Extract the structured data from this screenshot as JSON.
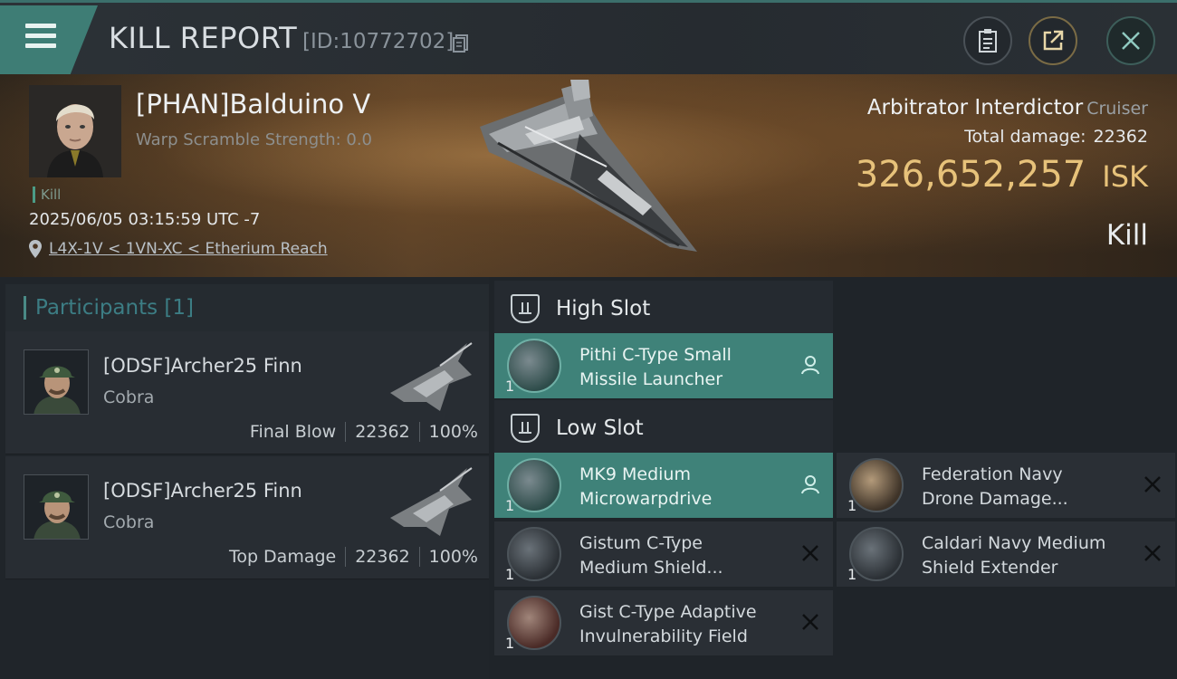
{
  "header": {
    "title": "KILL REPORT",
    "report_id": "[ID:10772702]"
  },
  "victim": {
    "name": "[PHAN]Balduino V",
    "warp_scramble": "Warp Scramble Strength: 0.0",
    "badge": "Kill",
    "timestamp": "2025/06/05 03:15:59 UTC -7",
    "location": "L4X-1V < 1VN-XC < Etherium Reach",
    "ship_name": "Arbitrator Interdictor",
    "ship_class": "Cruiser",
    "total_damage_label": "Total damage:",
    "total_damage": "22362",
    "isk_value": "326,652,257",
    "isk_unit": "ISK",
    "result": "Kill"
  },
  "participants": {
    "header": "Participants [1]",
    "items": [
      {
        "name": "[ODSF]Archer25 Finn",
        "ship": "Cobra",
        "role": "Final Blow",
        "damage": "22362",
        "percent": "100%"
      },
      {
        "name": "[ODSF]Archer25 Finn",
        "ship": "Cobra",
        "role": "Top Damage",
        "damage": "22362",
        "percent": "100%"
      }
    ]
  },
  "fitting": {
    "high_slot": {
      "title": "High Slot",
      "modules": [
        {
          "line1": "Pithi C-Type Small",
          "line2": "Missile Launcher",
          "qty": "1",
          "status": "user"
        }
      ]
    },
    "low_slot": {
      "title": "Low Slot",
      "modules": [
        {
          "line1": "MK9 Medium",
          "line2": "Microwarpdrive",
          "qty": "1",
          "status": "user"
        },
        {
          "line1": "Federation Navy",
          "line2": "Drone Damage...",
          "qty": "1",
          "status": "destroyed"
        },
        {
          "line1": "Gistum C-Type",
          "line2": "Medium Shield...",
          "qty": "1",
          "status": "destroyed"
        },
        {
          "line1": "Caldari Navy Medium",
          "line2": "Shield Extender",
          "qty": "1",
          "status": "destroyed"
        },
        {
          "line1": "Gist C-Type Adaptive",
          "line2": "Invulnerability Field",
          "qty": "1",
          "status": "destroyed"
        }
      ]
    }
  },
  "colors": {
    "accent": "#3f8279",
    "isk": "#e7c27a",
    "panel": "#2a2f35"
  }
}
